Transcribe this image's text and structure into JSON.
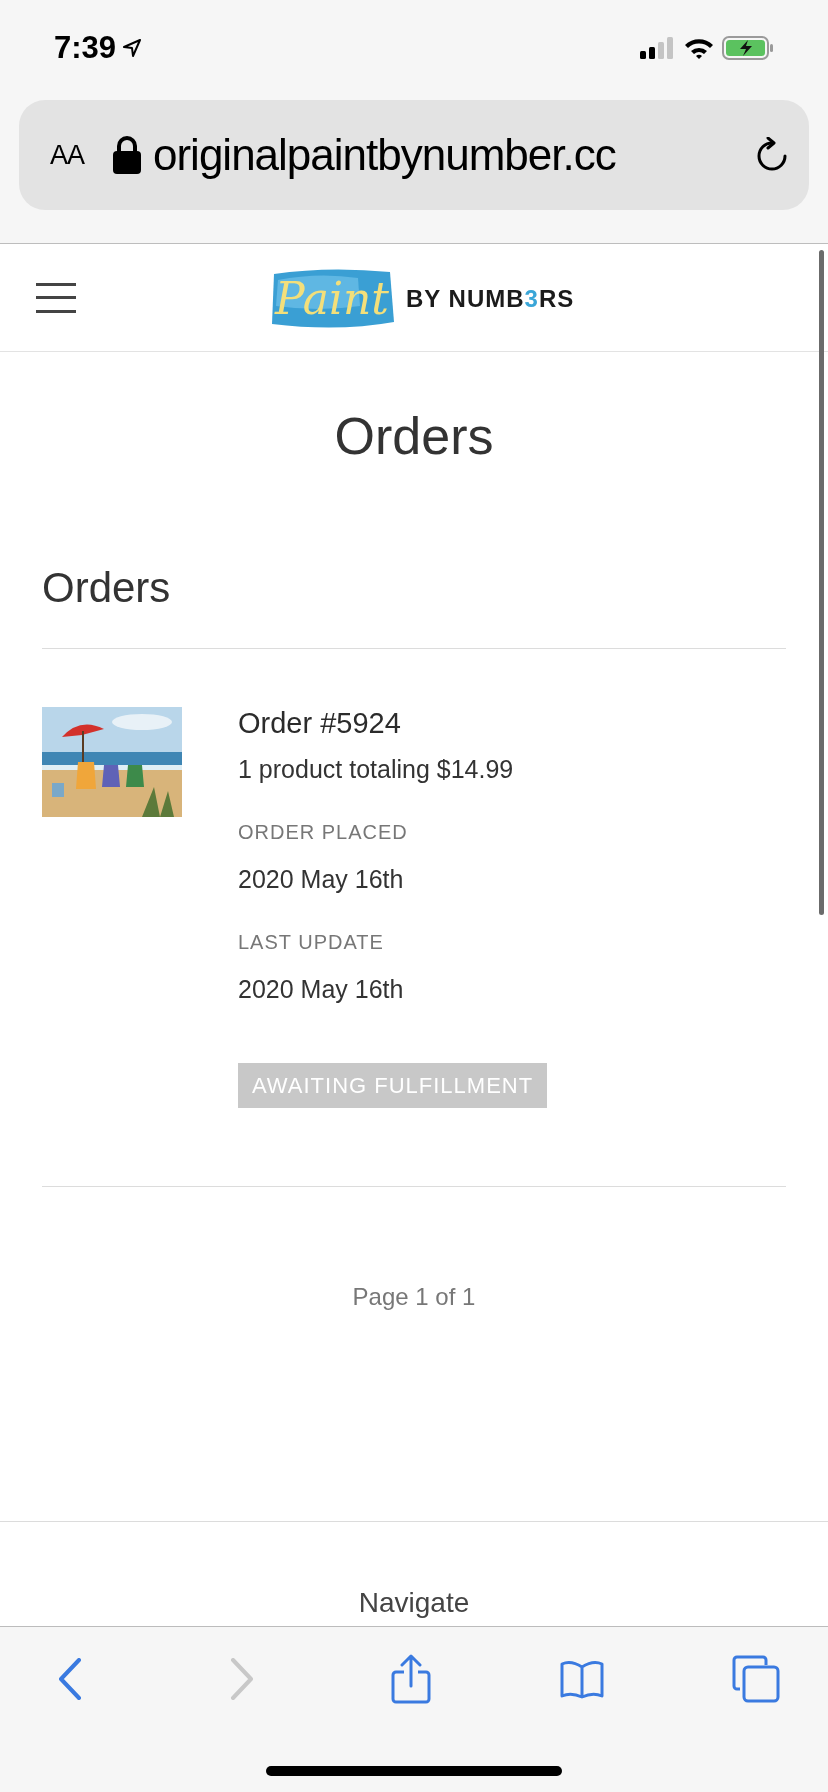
{
  "status_bar": {
    "time": "7:39"
  },
  "browser": {
    "text_size": "AA",
    "url": "originalpaintbynumber.cc",
    "back_enabled": true,
    "forward_enabled": false
  },
  "header": {
    "logo": {
      "script": "Paint",
      "wordmark_before": "BY NUMB",
      "wordmark_accent": "3",
      "wordmark_after": "RS"
    }
  },
  "page_title": "Orders",
  "section_title": "Orders",
  "orders": [
    {
      "title": "Order #5924",
      "summary": "1 product totaling $14.99",
      "fields": [
        {
          "label": "ORDER PLACED",
          "value": "2020 May 16th"
        },
        {
          "label": "LAST UPDATE",
          "value": "2020 May 16th"
        }
      ],
      "status": "AWAITING FULFILLMENT"
    }
  ],
  "pagination": "Page 1 of 1",
  "footer": {
    "heading": "Navigate"
  }
}
